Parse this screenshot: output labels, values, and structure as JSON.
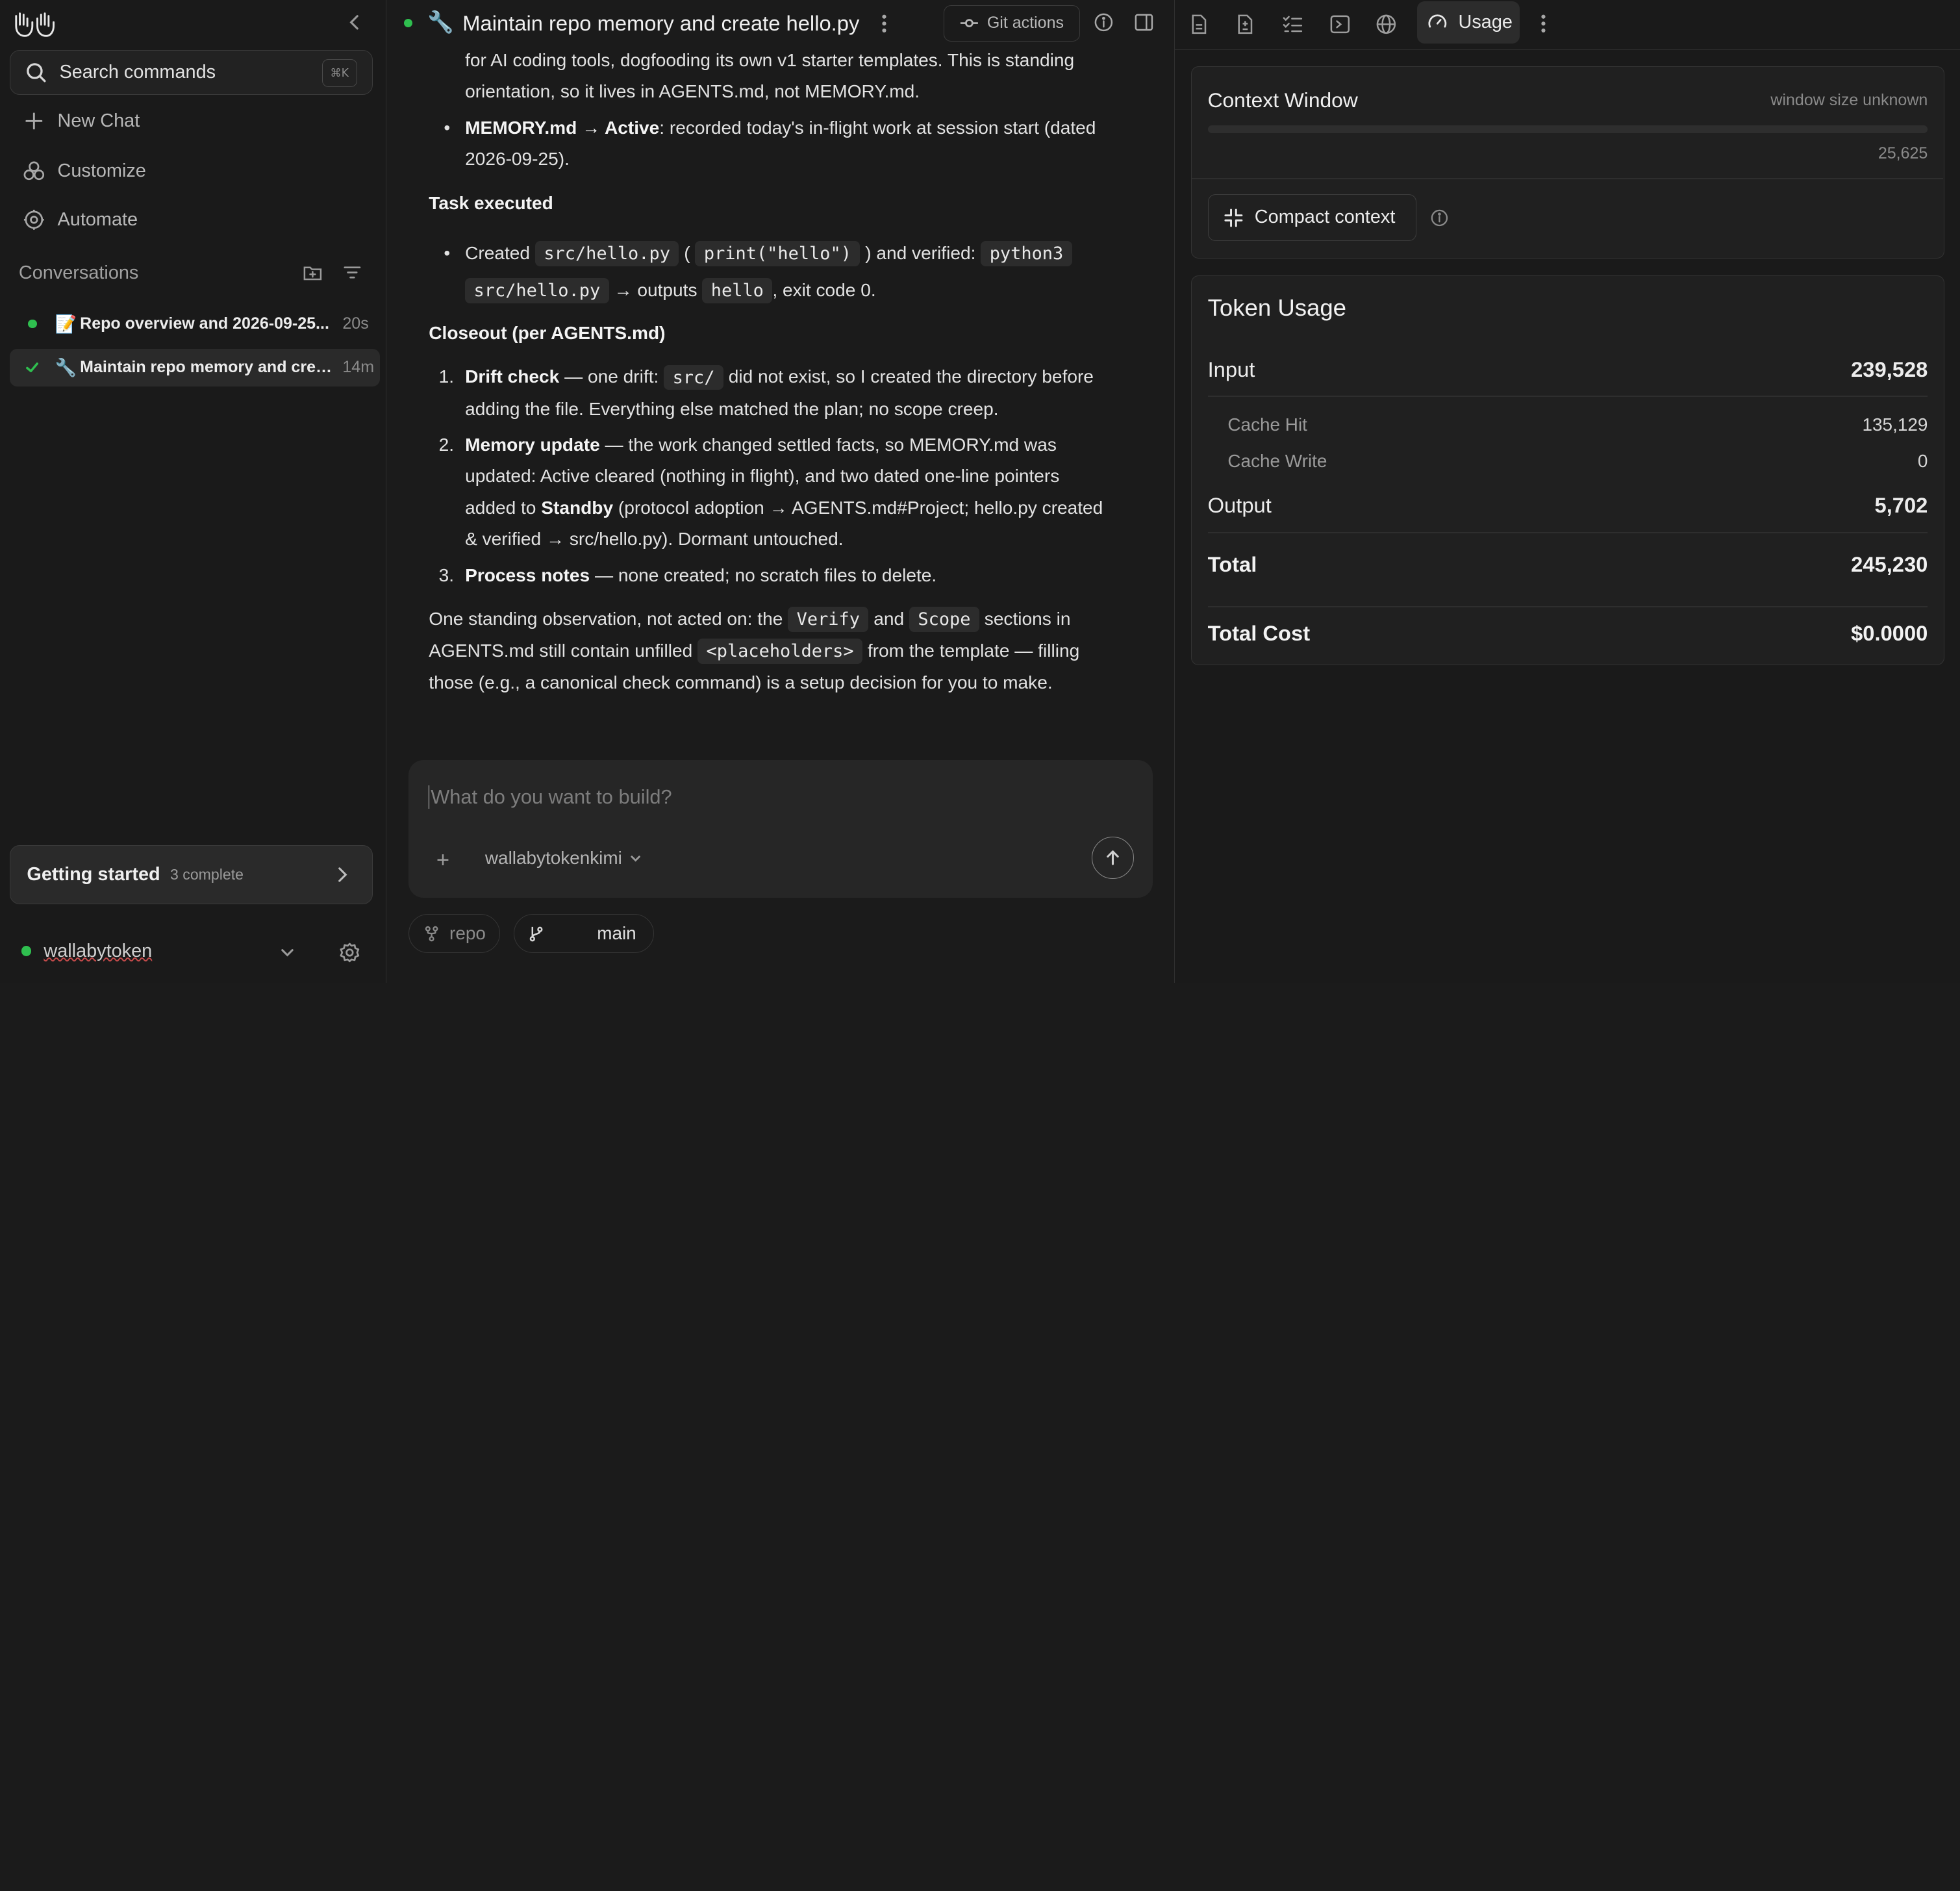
{
  "sidebar": {
    "search_label": "Search commands",
    "search_shortcut": "⌘K",
    "nav": {
      "new_chat": "New Chat",
      "customize": "Customize",
      "automate": "Automate"
    },
    "conversations_title": "Conversations",
    "conversations": [
      {
        "emoji": "📝",
        "title": "Repo overview and 2026-09-25...",
        "time": "20s",
        "status": "running"
      },
      {
        "emoji": "🔧",
        "title": "Maintain repo memory and crea...",
        "time": "14m",
        "status": "done"
      }
    ],
    "getting_started": {
      "title": "Getting started",
      "subtitle": "3 complete"
    },
    "user": {
      "name": "wallabytoken",
      "status_color": "#2fbf4f"
    }
  },
  "chat": {
    "header": {
      "emoji": "🔧",
      "title": "Maintain repo memory and create hello.py",
      "git_actions": "Git actions"
    },
    "message": {
      "p1_tail1": "for AI coding tools, dogfooding its own v1 starter templates. This is standing",
      "p1_tail2": "orientation, so it lives in AGENTS.md, not MEMORY.md.",
      "memory_bold": "MEMORY.md → Active",
      "memory_rest": ": recorded today's in-flight work at session start (dated",
      "memory_rest2": "2026-09-25).",
      "task_heading": "Task executed",
      "task_created": "Created",
      "task_code1": "src/hello.py",
      "task_paren_open": "(",
      "task_code2": "print(\"hello\")",
      "task_verified": ") and verified:",
      "task_code3a": "python3",
      "task_code3b": "src/hello.py",
      "task_outputs": "→ outputs",
      "task_code4": "hello",
      "task_exit": ", exit code 0.",
      "closeout_heading": "Closeout (per AGENTS.md)",
      "item1_num": "1.",
      "item1_bold": "Drift check",
      "item1_a": " — one drift:",
      "item1_code": "src/",
      "item1_b": " did not exist, so I created the directory before",
      "item1_c": "adding the file. Everything else matched the plan; no scope creep.",
      "item2_num": "2.",
      "item2_bold": "Memory update",
      "item2_a": " — the work changed settled facts, so MEMORY.md was",
      "item2_b": "updated: Active cleared (nothing in flight), and two dated one-line pointers",
      "item2_c1": "added to ",
      "item2_c_bold": "Standby",
      "item2_c2": " (protocol adoption → AGENTS.md#Project; hello.py created",
      "item2_d": "& verified → src/hello.py). Dormant untouched.",
      "item3_num": "3.",
      "item3_bold": "Process notes",
      "item3_a": " — none created; no scratch files to delete.",
      "obs_a": "One standing observation, not acted on: the",
      "obs_code1": "Verify",
      "obs_and": "and",
      "obs_code2": "Scope",
      "obs_b": "sections in",
      "obs_c": "AGENTS.md still contain unfilled",
      "obs_code3": "<placeholders>",
      "obs_d": "from the template — filling",
      "obs_e": "those (e.g., a canonical check command) is a setup decision for you to make."
    },
    "composer": {
      "placeholder": "What do you want to build?",
      "model": "wallabytokenkimi"
    },
    "chips": {
      "repo": "repo",
      "branch": "main"
    }
  },
  "right_panel": {
    "active_tab": "Usage",
    "context_window": {
      "title": "Context Window",
      "window_size": "window size unknown",
      "token_count": "25,625",
      "compact_label": "Compact context"
    },
    "token_usage": {
      "title": "Token Usage",
      "input_label": "Input",
      "input_value": "239,528",
      "cache_hit_label": "Cache Hit",
      "cache_hit_value": "135,129",
      "cache_write_label": "Cache Write",
      "cache_write_value": "0",
      "output_label": "Output",
      "output_value": "5,702",
      "total_label": "Total",
      "total_value": "245,230",
      "cost_label": "Total Cost",
      "cost_value": "$0.0000"
    }
  }
}
